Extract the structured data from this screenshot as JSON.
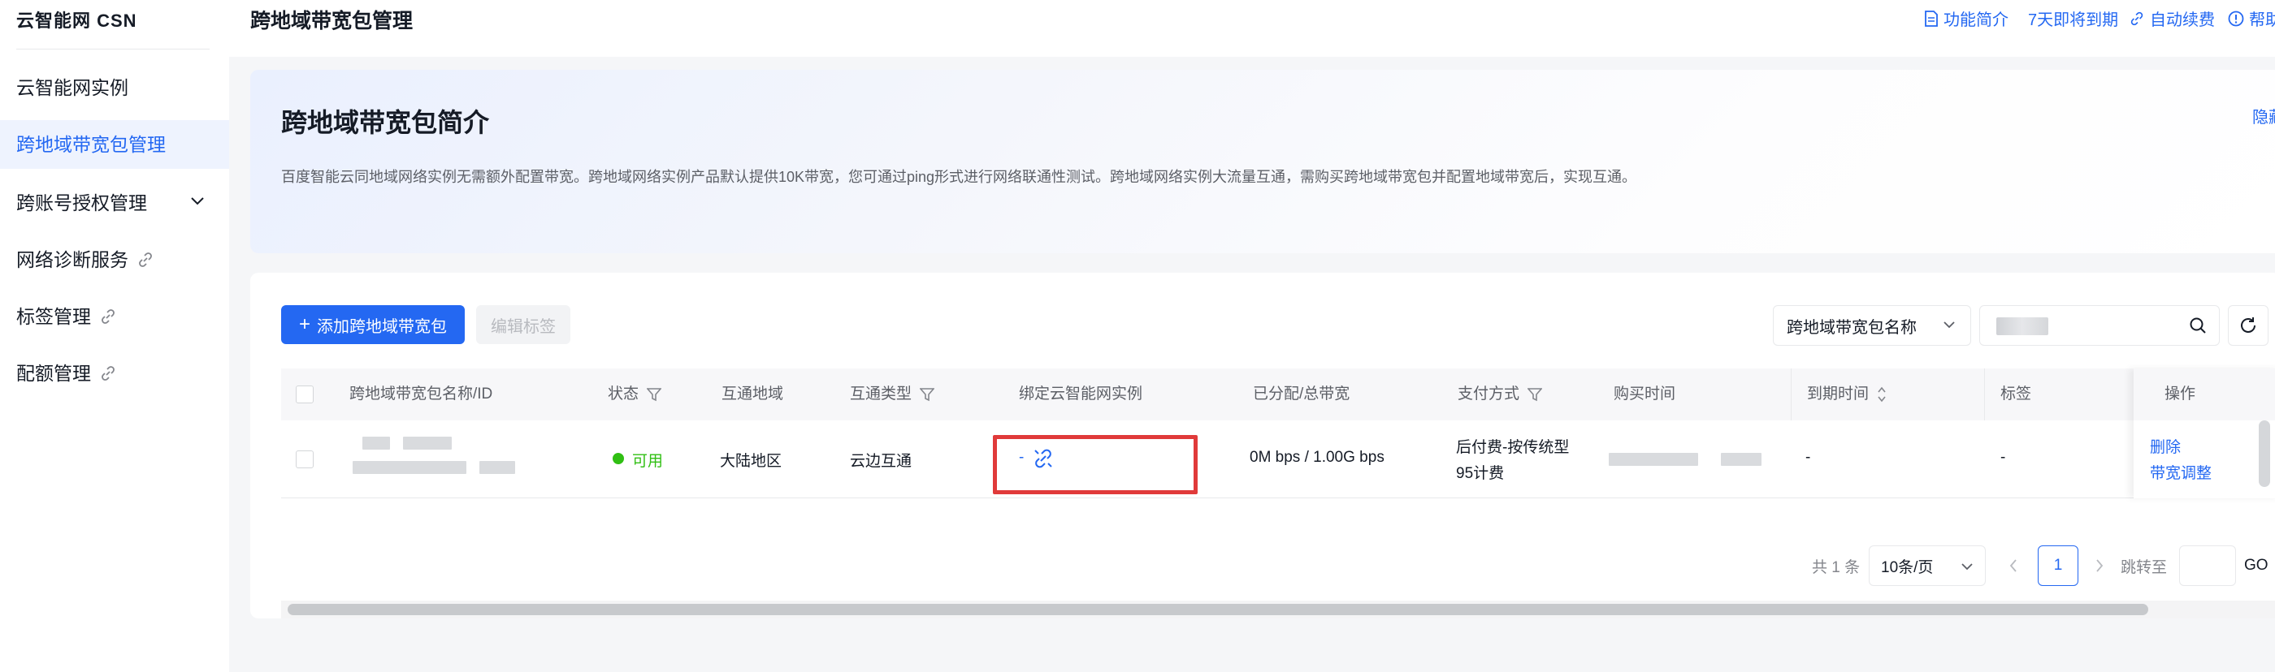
{
  "sidebar": {
    "brand": "云智能网 CSN",
    "items": [
      {
        "label": "云智能网实例"
      },
      {
        "label": "跨地域带宽包管理"
      },
      {
        "label": "跨账号授权管理"
      },
      {
        "label": "网络诊断服务"
      },
      {
        "label": "标签管理"
      },
      {
        "label": "配额管理"
      }
    ]
  },
  "header": {
    "title": "跨地域带宽包管理",
    "links": {
      "intro": "功能简介",
      "expiring": "7天即将到期",
      "autorenew": "自动续费",
      "help": "帮助"
    }
  },
  "intro": {
    "title": "跨地域带宽包简介",
    "description": "百度智能云同地域网络实例无需额外配置带宽。跨地域网络实例产品默认提供10K带宽，您可通过ping形式进行网络联通性测试。跨地域网络实例大流量互通，需购买跨地域带宽包并配置地域带宽后，实现互通。",
    "hide": "隐藏"
  },
  "toolbar": {
    "add_label": "添加跨地域带宽包",
    "edit_label": "编辑标签",
    "filter_select": "跨地域带宽包名称"
  },
  "table": {
    "columns": [
      "跨地域带宽包名称/ID",
      "状态",
      "互通地域",
      "互通类型",
      "绑定云智能网实例",
      "已分配/总带宽",
      "支付方式",
      "购买时间",
      "到期时间",
      "标签",
      "操作"
    ],
    "rows": [
      {
        "status": "可用",
        "region": "大陆地区",
        "type": "云边互通",
        "bound_instance": "-",
        "bandwidth": "0M bps / 1.00G bps",
        "payment_line1": "后付费-按传统型",
        "payment_line2": "95计费",
        "expire": "-",
        "tags": "-",
        "actions": [
          "删除",
          "带宽调整"
        ]
      }
    ]
  },
  "pagination": {
    "total": "共 1 条",
    "page_size": "10条/页",
    "current_page": "1",
    "jump_label": "跳转至",
    "go_label": "GO"
  },
  "colors": {
    "accent": "#2468f2",
    "success": "#30bf13",
    "highlight": "#e03a3a"
  }
}
